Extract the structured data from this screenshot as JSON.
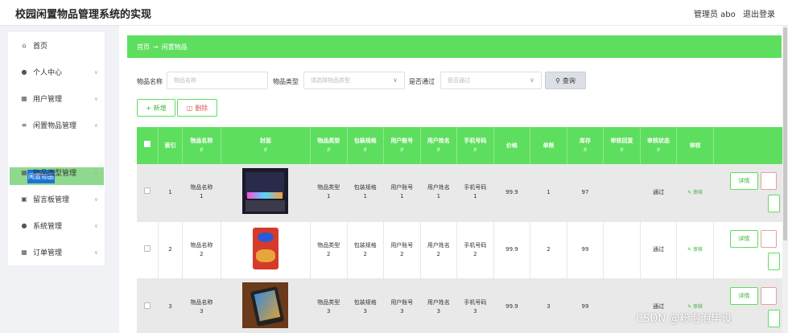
{
  "app": {
    "title": "校园闲置物品管理系统的实现",
    "user_label": "管理员 abo",
    "logout_label": "退出登录"
  },
  "sidebar": {
    "items": [
      {
        "label": "首页",
        "icon": "home-icon"
      },
      {
        "label": "个人中心",
        "icon": "user-icon"
      },
      {
        "label": "用户管理",
        "icon": "grid-icon"
      },
      {
        "label": "闲置物品管理",
        "icon": "menu-icon"
      },
      {
        "label": "物品类型管理",
        "icon": "grid-icon"
      },
      {
        "label": "留言板管理",
        "icon": "board-icon"
      },
      {
        "label": "系统管理",
        "icon": "user-icon"
      },
      {
        "label": "订单管理",
        "icon": "grid-icon"
      }
    ],
    "active_sub": "闲置物品"
  },
  "breadcrumb": {
    "home": "首页",
    "separator": "→",
    "current": "闲置物品"
  },
  "filters": {
    "name_label": "物品名称",
    "name_placeholder": "物品名称",
    "type_label": "物品类型",
    "type_placeholder": "请选择物品类型",
    "pass_label": "是否通过",
    "pass_placeholder": "是否通过",
    "query_label": "查询"
  },
  "actions": {
    "add_label": "+ 新增",
    "delete_label": "删除"
  },
  "table": {
    "headers": [
      "索引",
      "物品名称",
      "封面",
      "物品类型",
      "包装规格",
      "用户账号",
      "用户姓名",
      "手机号码",
      "价格",
      "单限",
      "库存",
      "审核回复",
      "审核状态",
      "审核"
    ],
    "rows": [
      {
        "index": "1",
        "name": "物品名称\n1",
        "type": "物品类型\n1",
        "spec": "包装规格\n1",
        "account": "用户账号\n1",
        "username": "用户姓名\n1",
        "phone": "手机号码\n1",
        "price": "99.9",
        "limit": "1",
        "stock": "97",
        "reply": "",
        "status": "通过",
        "review": "审核",
        "detail": "详情"
      },
      {
        "index": "2",
        "name": "物品名称\n2",
        "type": "物品类型\n2",
        "spec": "包装规格\n2",
        "account": "用户账号\n2",
        "username": "用户姓名\n2",
        "phone": "手机号码\n2",
        "price": "99.9",
        "limit": "2",
        "stock": "99",
        "reply": "",
        "status": "通过",
        "review": "审核",
        "detail": "详情"
      },
      {
        "index": "3",
        "name": "物品名称\n3",
        "type": "物品类型\n3",
        "spec": "包装规格\n3",
        "account": "用户账号\n3",
        "username": "用户姓名\n3",
        "phone": "手机号码\n3",
        "price": "99.9",
        "limit": "3",
        "stock": "99",
        "reply": "",
        "status": "通过",
        "review": "审核",
        "detail": "详情"
      }
    ]
  },
  "watermark": "CSDN @粉泡泡毕设",
  "colors": {
    "accent": "#5ede5e",
    "accent_dark": "#3cb33c",
    "danger": "#e05555",
    "active_highlight": "#1a73d9"
  }
}
